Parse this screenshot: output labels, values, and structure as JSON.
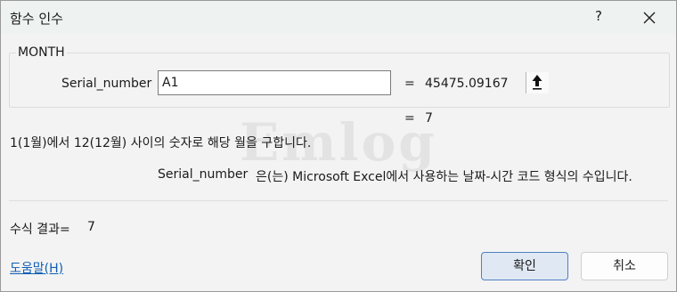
{
  "window": {
    "title": "함수 인수",
    "help_glyph": "?",
    "close_icon": "close-icon"
  },
  "function_group": {
    "name": "MONTH",
    "argument": {
      "label": "Serial_number",
      "value": "A1",
      "collapse_icon": "collapse-up-arrow-icon",
      "equals": "=",
      "evaluated": "45475.09167"
    }
  },
  "result_preview": {
    "equals": "=",
    "value": "7"
  },
  "description": "1(1월)에서 12(12월) 사이의 숫자로 해당 월을 구합니다.",
  "argument_description": {
    "name": "Serial_number",
    "text": "은(는) Microsoft Excel에서 사용하는 날짜-시간 코드 형식의 수입니다."
  },
  "formula_result": {
    "label": "수식 결과=",
    "value": "7"
  },
  "help_link": "도움말(H)",
  "buttons": {
    "ok": "확인",
    "cancel": "취소"
  },
  "watermark": "Emlog",
  "colors": {
    "accent_border": "#4f80c4",
    "link": "#0f5fb4",
    "titlebar": "#eef3f1"
  }
}
